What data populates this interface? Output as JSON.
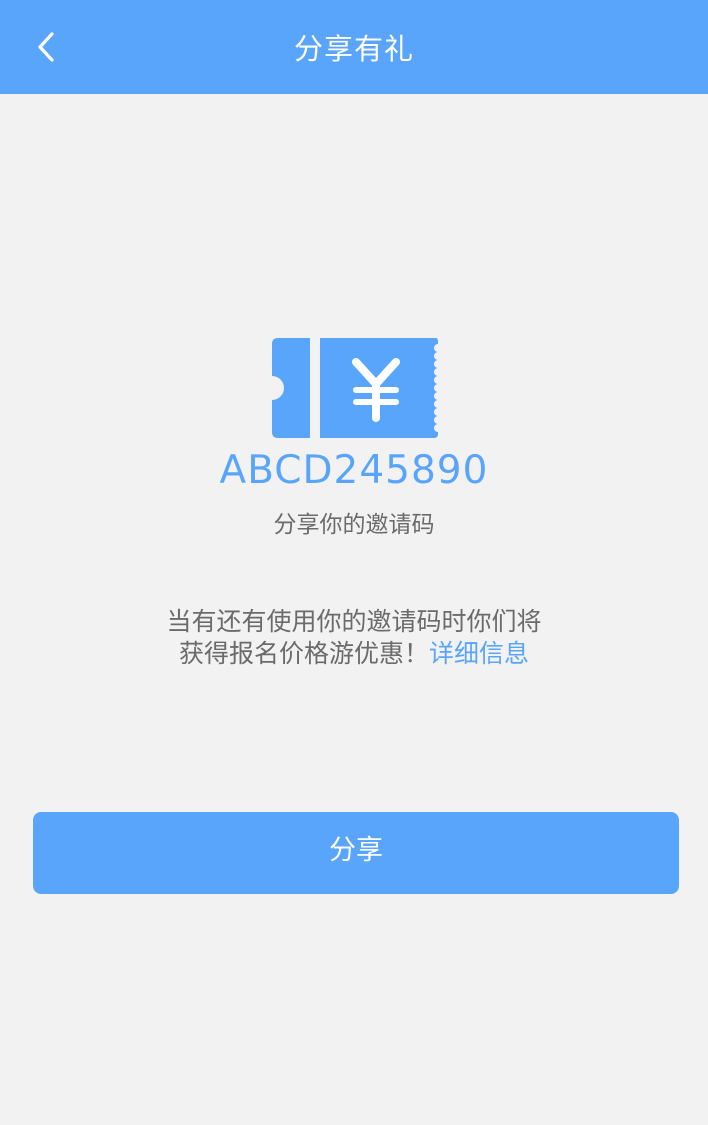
{
  "header": {
    "title": "分享有礼",
    "back_icon": "chevron-left-icon"
  },
  "ticket": {
    "icon": "yen-ticket-icon",
    "symbol": "¥",
    "color": "#5aa5fc"
  },
  "invite": {
    "code": "ABCD245890",
    "caption": "分享你的邀请码"
  },
  "description": {
    "line1": "当有还有使用你的邀请码时你们将",
    "line2": "获得报名价格游优惠！",
    "link_label": "详细信息"
  },
  "share_button": {
    "label": "分享"
  },
  "colors": {
    "accent": "#5aa5fc",
    "background": "#f2f2f2",
    "text": "#6b6b6b"
  }
}
